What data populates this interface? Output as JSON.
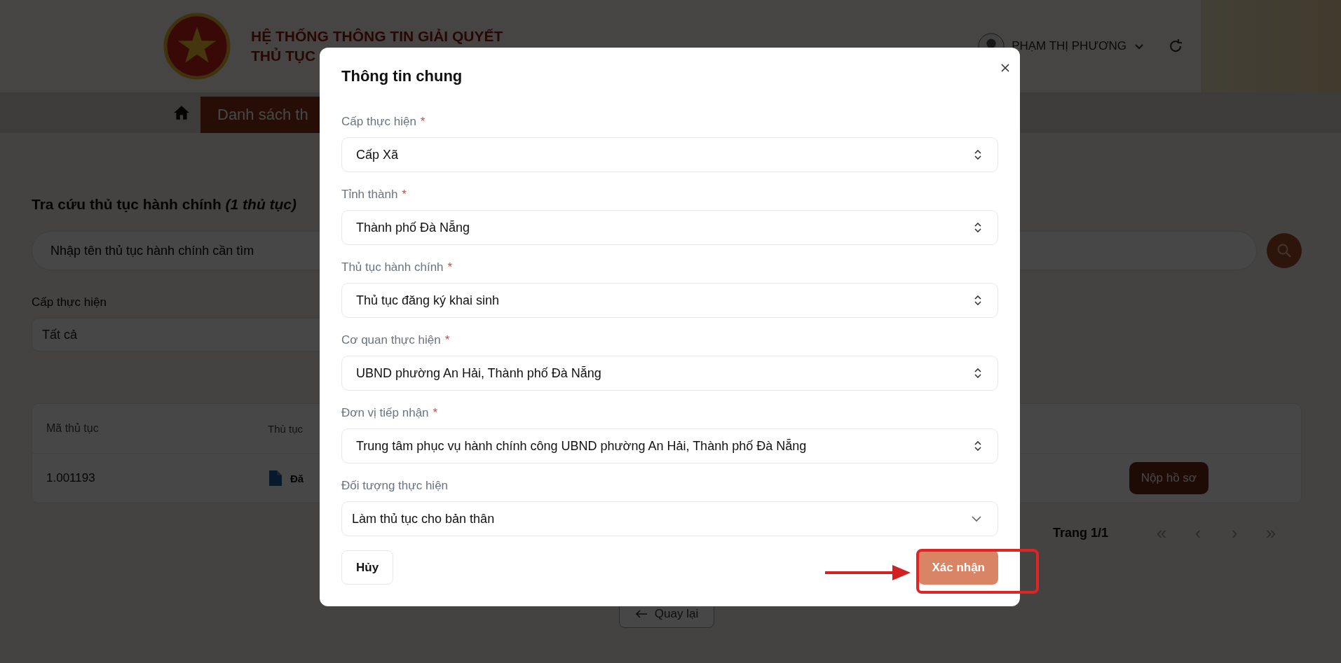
{
  "header": {
    "title_lines": [
      "HỆ THỐNG THÔNG TIN GIẢI QUYẾT",
      "THỦ TỤC"
    ],
    "user_name": "PHẠM THỊ PHƯƠNG"
  },
  "nav": {
    "tabs": [
      {
        "label": "Danh sách th",
        "selected": true
      }
    ]
  },
  "search_page": {
    "title": "Tra cứu thủ tục hành chính *(1 thủ tục)*",
    "search_placeholder": "Nhập tên thủ tục hành chính cần tìm",
    "filter_label": "Cấp thực hiện",
    "filter_value": "Tất cả"
  },
  "table": {
    "columns": [
      "Mã thủ tục",
      "Thủ tục"
    ],
    "rows": [
      {
        "code": "1.001193",
        "name": "Đă",
        "action": "Nộp hồ sơ"
      }
    ]
  },
  "pagination": {
    "label": "Trang 1/1",
    "buttons": [
      "«",
      "‹",
      "›",
      "»"
    ]
  },
  "back_button": "Quay lại",
  "dialog": {
    "title": "Thông tin chung",
    "fields": [
      {
        "label": "Cấp thực hiện",
        "marker": "*",
        "value": "Cấp Xã",
        "kind": "select"
      },
      {
        "label": "Tỉnh thành",
        "marker": "*",
        "value": "Thành phố Đà Nẵng",
        "kind": "select"
      },
      {
        "label": "Thủ tục hành chính",
        "marker": "*",
        "value": "Thủ tục đăng ký khai sinh",
        "kind": "select"
      },
      {
        "label": "Cơ quan thực hiện",
        "marker": "*",
        "value": "UBND phường An Hải, Thành phố Đà Nẵng",
        "kind": "select"
      },
      {
        "label": "Đơn vị tiếp nhận",
        "marker": "*",
        "value": "Trung tâm phục vụ hành chính công UBND phường An Hải, Thành phố Đà Nẵng",
        "kind": "select"
      },
      {
        "label": "Đối tượng thực hiện",
        "value": "Làm thủ tục cho bản thân",
        "kind": "dropdown"
      }
    ],
    "cancel_button": "Hủy",
    "confirm_button": "Xác nhận"
  }
}
